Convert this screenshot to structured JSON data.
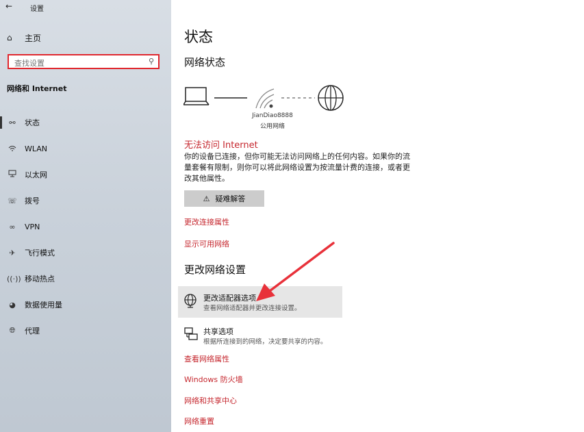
{
  "window": {
    "title": "设置",
    "back_icon": "back-arrow-icon"
  },
  "sidebar": {
    "home_label": "主页",
    "search_placeholder": "查找设置",
    "section_title": "网络和 Internet",
    "items": [
      {
        "label": "状态",
        "icon": "globe-network-icon",
        "active": true
      },
      {
        "label": "WLAN",
        "icon": "wifi-icon",
        "active": false
      },
      {
        "label": "以太网",
        "icon": "ethernet-icon",
        "active": false
      },
      {
        "label": "拨号",
        "icon": "dialup-icon",
        "active": false
      },
      {
        "label": "VPN",
        "icon": "vpn-icon",
        "active": false
      },
      {
        "label": "飞行模式",
        "icon": "airplane-icon",
        "active": false
      },
      {
        "label": "移动热点",
        "icon": "hotspot-icon",
        "active": false
      },
      {
        "label": "数据使用量",
        "icon": "data-usage-icon",
        "active": false
      },
      {
        "label": "代理",
        "icon": "proxy-globe-icon",
        "active": false
      }
    ]
  },
  "main": {
    "page_title": "状态",
    "network_status_heading": "网络状态",
    "network_name": "JianDiao8888",
    "network_type": "公用网络",
    "warning_title": "无法访问 Internet",
    "warning_body": "你的设备已连接，但你可能无法访问网络上的任何内容。如果你的流量套餐有限制，则你可以将此网络设置为按流量计费的连接，或者更改其他属性。",
    "troubleshoot_label": "疑难解答",
    "link_change_properties": "更改连接属性",
    "link_show_networks": "显示可用网络",
    "change_settings_heading": "更改网络设置",
    "adapter_option": {
      "title": "更改适配器选项",
      "subtitle": "查看网络适配器并更改连接设置。"
    },
    "sharing_option": {
      "title": "共享选项",
      "subtitle": "根据所连接到的网络，决定要共享的内容。"
    },
    "link_view_properties": "查看网络属性",
    "link_firewall": "Windows 防火墙",
    "link_sharing_center": "网络和共享中心",
    "link_network_reset": "网络重置"
  },
  "colors": {
    "accent_red": "#c5262d",
    "search_border": "#e0272e",
    "highlight": "#e6e6e6"
  }
}
